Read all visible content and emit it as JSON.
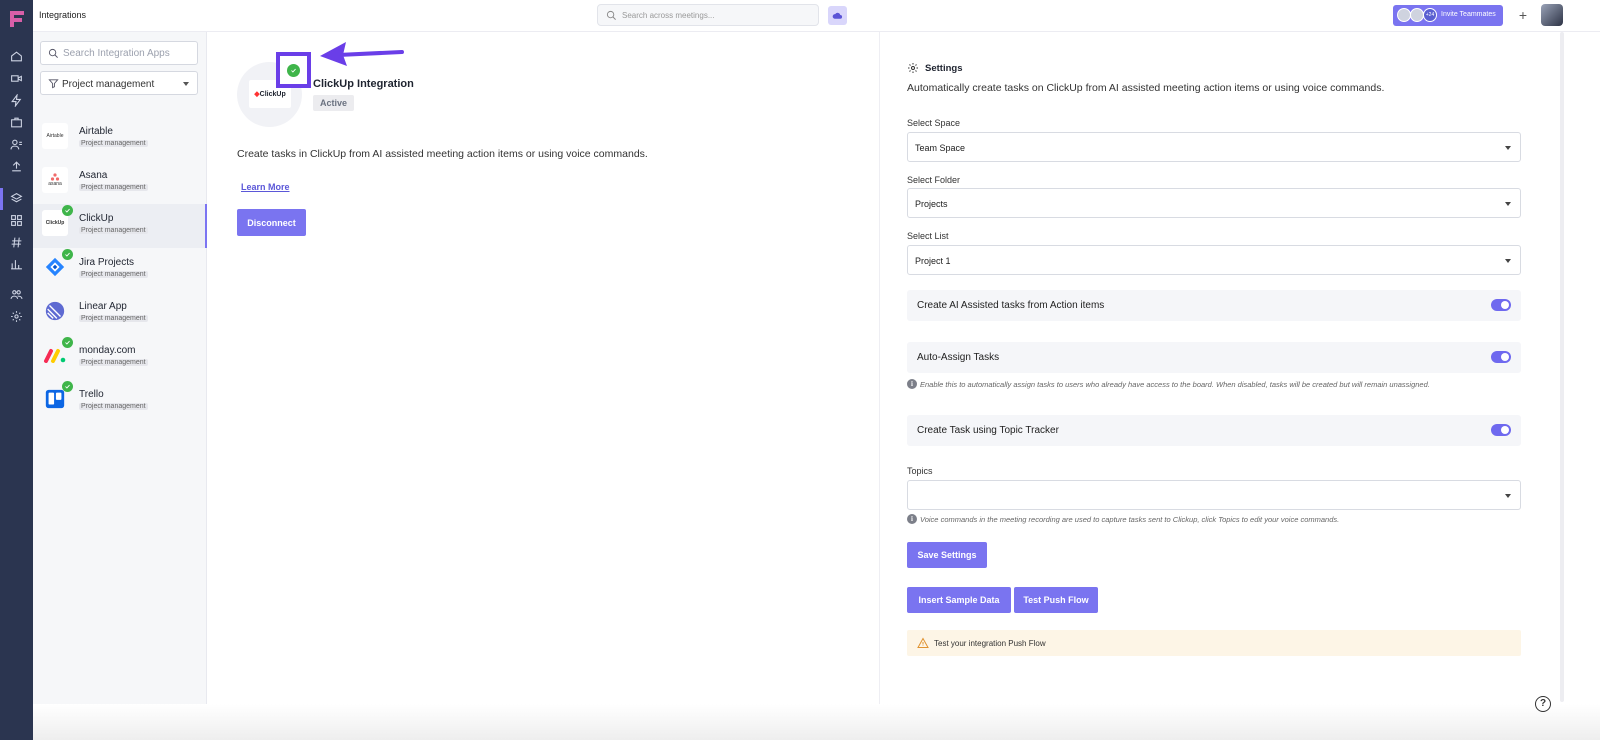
{
  "header": {
    "title": "Integrations",
    "search_placeholder": "Search across meetings...",
    "invite_label": "Invite Teammates",
    "invite_count": "+24",
    "plus": "+"
  },
  "sidebar": {
    "search_placeholder": "Search Integration Apps",
    "filter_label": "Project management",
    "apps": [
      {
        "name": "Airtable",
        "category": "Project management",
        "connected": false
      },
      {
        "name": "Asana",
        "category": "Project management",
        "connected": false
      },
      {
        "name": "ClickUp",
        "category": "Project management",
        "connected": true,
        "active": true
      },
      {
        "name": "Jira Projects",
        "category": "Project management",
        "connected": true
      },
      {
        "name": "Linear App",
        "category": "Project management",
        "connected": false
      },
      {
        "name": "monday.com",
        "category": "Project management",
        "connected": true
      },
      {
        "name": "Trello",
        "category": "Project management",
        "connected": true
      }
    ],
    "logo_text": {
      "airtable": "Airtable",
      "asana": "asana",
      "clickup": "ClickUp"
    }
  },
  "integration": {
    "logo_text": "ClickUp",
    "title": "ClickUp Integration",
    "status": "Active",
    "description": "Create tasks in ClickUp from AI assisted meeting action items or using voice commands.",
    "learn_more": "Learn More",
    "disconnect": "Disconnect"
  },
  "settings": {
    "heading": "Settings",
    "description": "Automatically create tasks on ClickUp from AI assisted meeting action items or using voice commands.",
    "space_label": "Select Space",
    "space_value": "Team Space",
    "folder_label": "Select Folder",
    "folder_value": "Projects",
    "list_label": "Select List",
    "list_value": "Project 1",
    "toggle_ai": "Create AI Assisted tasks from Action items",
    "toggle_assign": "Auto-Assign Tasks",
    "assign_hint": "Enable this to automatically assign tasks to users who already have access to the board. When disabled, tasks will be created but will remain unassigned.",
    "toggle_topic": "Create Task using Topic Tracker",
    "topics_label": "Topics",
    "topics_value": "",
    "topics_hint": "Voice commands in the meeting recording are used to capture tasks sent to Clickup, click Topics to edit your voice commands.",
    "save": "Save Settings",
    "insert_sample": "Insert Sample Data",
    "test_push": "Test Push Flow",
    "warning": "Test your integration Push Flow"
  },
  "help": "?",
  "colors": {
    "accent": "#7a74f0",
    "rail": "#2b3550",
    "success": "#3fb54a",
    "highlight": "#6a3ee8"
  }
}
